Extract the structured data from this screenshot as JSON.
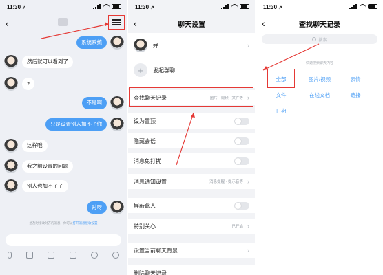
{
  "status_bar": {
    "time": "11:30",
    "location_glyph": "⇗"
  },
  "chat": {
    "menu_icon": "menu-icon",
    "messages": [
      {
        "side": "right",
        "text": "系统系统"
      },
      {
        "side": "left",
        "text": "然后就可以看到了"
      },
      {
        "side": "left",
        "text": "?"
      },
      {
        "side": "right",
        "text": "不是啊"
      },
      {
        "side": "right",
        "text": "只是设置别人加不了你"
      },
      {
        "side": "left",
        "text": "这样哦"
      },
      {
        "side": "left",
        "text": "我之前设置的问题"
      },
      {
        "side": "left",
        "text": "别人也加不了了"
      },
      {
        "side": "right",
        "text": "对呀"
      }
    ],
    "system_note_prefix": "想及时接收对方的消息，你可以",
    "system_note_link": "打开消息接收设置",
    "toolbar_icons": [
      "mic-icon",
      "image-icon",
      "camera-icon",
      "red-packet-icon",
      "emoji-icon",
      "plus-icon"
    ]
  },
  "settings": {
    "title": "聊天设置",
    "contact_name": "婵",
    "start_group": "发起群聊",
    "rows": [
      {
        "label": "查找聊天记录",
        "value": "图片 · 视频 · 文件等",
        "kind": "link"
      },
      {
        "label": "设为置顶",
        "kind": "toggle"
      },
      {
        "label": "隐藏会话",
        "kind": "toggle"
      },
      {
        "label": "消息免打扰",
        "kind": "toggle"
      },
      {
        "label": "消息通知设置",
        "value": "消息提醒 · 提示音等",
        "kind": "link"
      },
      {
        "label": "屏蔽此人",
        "kind": "toggle"
      },
      {
        "label": "特别关心",
        "value": "已开启",
        "kind": "link"
      },
      {
        "label": "设置当前聊天背景",
        "kind": "link"
      },
      {
        "label": "删除聊天记录",
        "kind": "link"
      }
    ]
  },
  "search_history": {
    "title": "查找聊天记录",
    "search_placeholder": "搜索",
    "hint": "快速搜索聊天内容",
    "categories": [
      "全部",
      "图片/视频",
      "表情",
      "文件",
      "在线文档",
      "链接",
      "日期"
    ]
  },
  "colors": {
    "accent": "#4d9ff5",
    "highlight": "#e53935"
  }
}
